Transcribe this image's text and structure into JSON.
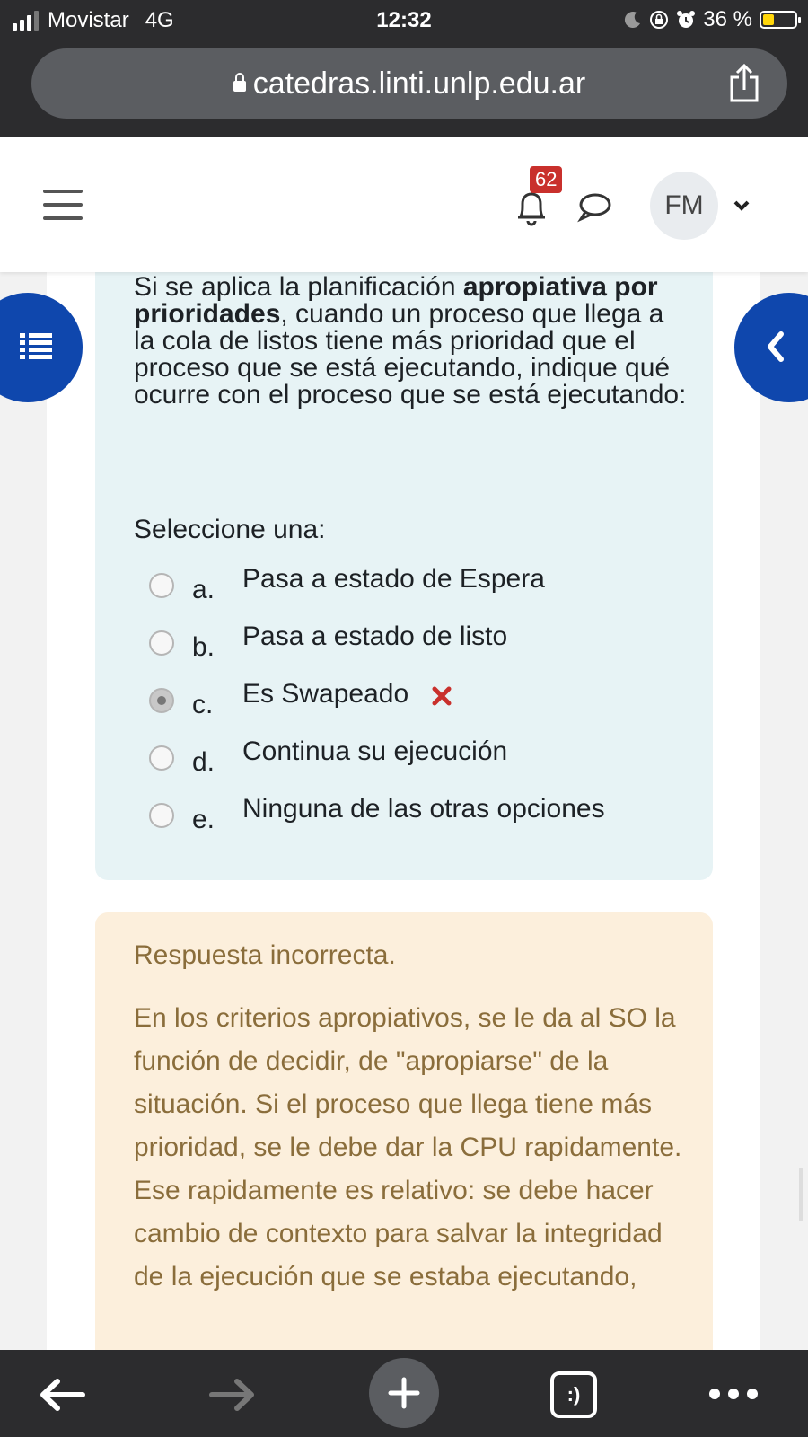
{
  "status_bar": {
    "carrier": "Movistar",
    "network": "4G",
    "time": "12:32",
    "battery": "36 %",
    "battery_color": "#ffd60a"
  },
  "browser": {
    "url": "catedras.linti.unlp.edu.ar"
  },
  "header": {
    "notifications_count": "62",
    "user_initials": "FM",
    "badge_color": "#c9302c"
  },
  "question": {
    "text_parts": [
      "Si se aplica la planificación ",
      "apropiativa por prioridades",
      ", cuando un proceso que llega a la cola de listos tiene más prioridad que el proceso que se está ejecutando, indique qué ocurre con el proceso que se está ejecutando:"
    ],
    "select_label": "Seleccione una:",
    "options": [
      {
        "letter": "a.",
        "text": "Pasa a estado de Espera",
        "selected": false
      },
      {
        "letter": "b.",
        "text": "Pasa a estado de listo",
        "selected": false
      },
      {
        "letter": "c.",
        "text": "Es Swapeado",
        "selected": true
      },
      {
        "letter": "d.",
        "text": "Continua su ejecución",
        "selected": false
      },
      {
        "letter": "e.",
        "text": "Ninguna de las otras opciones",
        "selected": false
      }
    ]
  },
  "feedback": {
    "title": "Respuesta incorrecta.",
    "text": "En los criterios apropiativos, se le da al SO la función de decidir, de \"apropiarse\" de la situación. Si el proceso que llega tiene más prioridad, se le debe dar la CPU rapidamente. Ese rapidamente es relativo: se debe hacer cambio de contexto para salvar la integridad de la ejecución que se estaba ejecutando,"
  },
  "colors": {
    "accent": "#0f47ad",
    "question_bg": "#e7f3f5",
    "feedback_bg": "#fcefdc",
    "feedback_text": "#8a6d3b",
    "wrong": "#c9302c"
  },
  "toolbar": {
    "tabs_label": ":)"
  }
}
